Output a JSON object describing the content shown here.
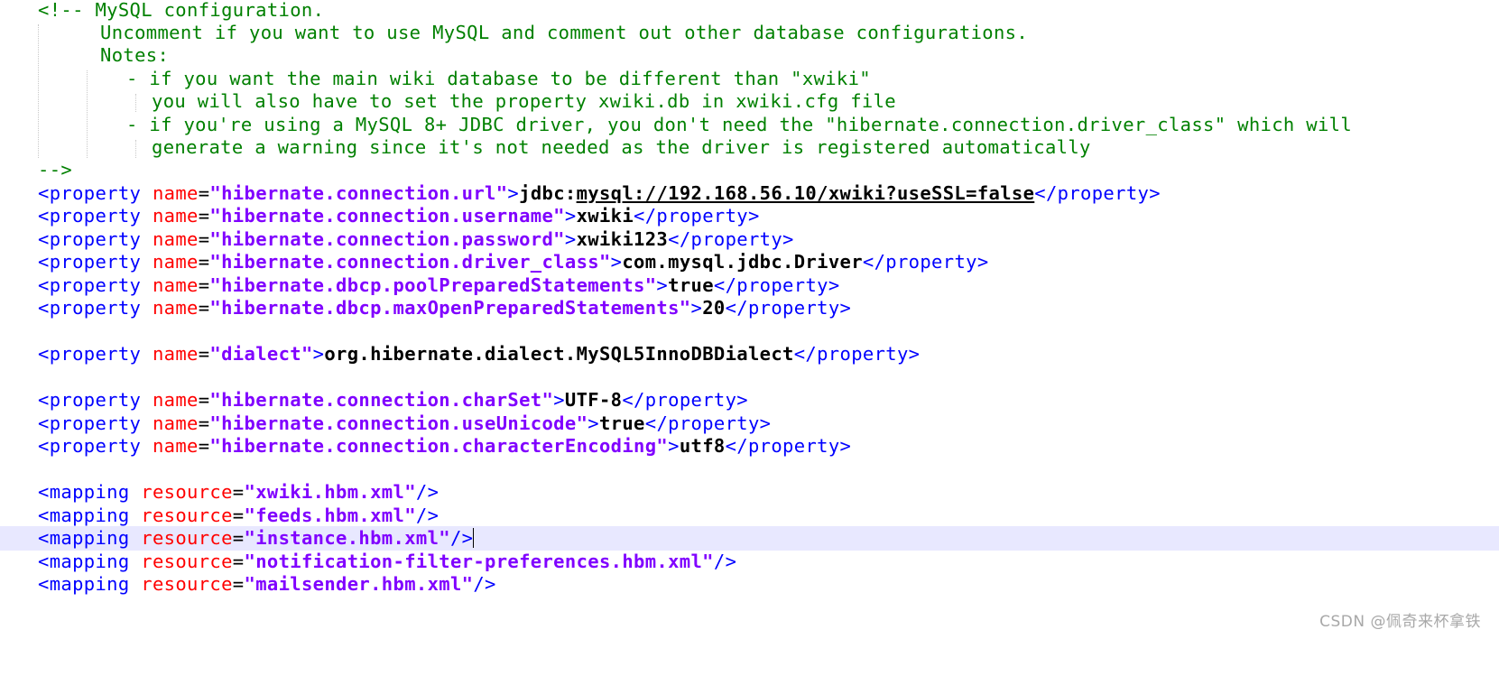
{
  "editor": {
    "comment_lines": [
      "<!-- MySQL configuration.",
      "Uncomment if you want to use MySQL and comment out other database configurations.",
      "Notes:",
      "- if you want the main wiki database to be different than \"xwiki\"",
      "you will also have to set the property xwiki.db in xwiki.cfg file",
      "- if you're using a MySQL 8+ JDBC driver, you don't need the \"hibernate.connection.driver_class\" which will",
      "generate a warning since it's not needed as the driver is registered automatically",
      "-->"
    ],
    "properties": [
      {
        "open_tag": "<property",
        "attr": "name",
        "eq": "=",
        "value": "\"hibernate.connection.url\"",
        "tag_end": ">",
        "text_prefix": "jdbc:",
        "text": "mysql://192.168.56.10/xwiki?useSSL=false",
        "close_tag": "</property>"
      },
      {
        "open_tag": "<property",
        "attr": "name",
        "eq": "=",
        "value": "\"hibernate.connection.username\"",
        "tag_end": ">",
        "text": "xwiki",
        "close_tag": "</property>"
      },
      {
        "open_tag": "<property",
        "attr": "name",
        "eq": "=",
        "value": "\"hibernate.connection.password\"",
        "tag_end": ">",
        "text": "xwiki123",
        "close_tag": "</property>"
      },
      {
        "open_tag": "<property",
        "attr": "name",
        "eq": "=",
        "value": "\"hibernate.connection.driver_class\"",
        "tag_end": ">",
        "text": "com.mysql.jdbc.Driver",
        "close_tag": "</property>"
      },
      {
        "open_tag": "<property",
        "attr": "name",
        "eq": "=",
        "value": "\"hibernate.dbcp.poolPreparedStatements\"",
        "tag_end": ">",
        "text": "true",
        "close_tag": "</property>"
      },
      {
        "open_tag": "<property",
        "attr": "name",
        "eq": "=",
        "value": "\"hibernate.dbcp.maxOpenPreparedStatements\"",
        "tag_end": ">",
        "text": "20",
        "close_tag": "</property>"
      },
      {
        "open_tag": "<property",
        "attr": "name",
        "eq": "=",
        "value": "\"dialect\"",
        "tag_end": ">",
        "text": "org.hibernate.dialect.MySQL5InnoDBDialect",
        "close_tag": "</property>"
      },
      {
        "open_tag": "<property",
        "attr": "name",
        "eq": "=",
        "value": "\"hibernate.connection.charSet\"",
        "tag_end": ">",
        "text": "UTF-8",
        "close_tag": "</property>"
      },
      {
        "open_tag": "<property",
        "attr": "name",
        "eq": "=",
        "value": "\"hibernate.connection.useUnicode\"",
        "tag_end": ">",
        "text": "true",
        "close_tag": "</property>"
      },
      {
        "open_tag": "<property",
        "attr": "name",
        "eq": "=",
        "value": "\"hibernate.connection.characterEncoding\"",
        "tag_end": ">",
        "text": "utf8",
        "close_tag": "</property>"
      }
    ],
    "mappings": [
      {
        "open_tag": "<mapping",
        "attr": "resource",
        "eq": "=",
        "value": "\"xwiki.hbm.xml\"",
        "close": "/>"
      },
      {
        "open_tag": "<mapping",
        "attr": "resource",
        "eq": "=",
        "value": "\"feeds.hbm.xml\"",
        "close": "/>"
      },
      {
        "open_tag": "<mapping",
        "attr": "resource",
        "eq": "=",
        "value": "\"instance.hbm.xml\"",
        "close": "/>"
      },
      {
        "open_tag": "<mapping",
        "attr": "resource",
        "eq": "=",
        "value": "\"notification-filter-preferences.hbm.xml\"",
        "close": "/>"
      },
      {
        "open_tag": "<mapping",
        "attr": "resource",
        "eq": "=",
        "value": "\"mailsender.hbm.xml\"",
        "close": "/>"
      }
    ],
    "current_line_mapping_index": 2
  },
  "watermark": "CSDN @佩奇来杯拿铁",
  "colors": {
    "comment": "#008000",
    "tag": "#0000ff",
    "attribute": "#ff0000",
    "string": "#8000ff",
    "text": "#000000",
    "current_line": "#e8e8ff"
  }
}
